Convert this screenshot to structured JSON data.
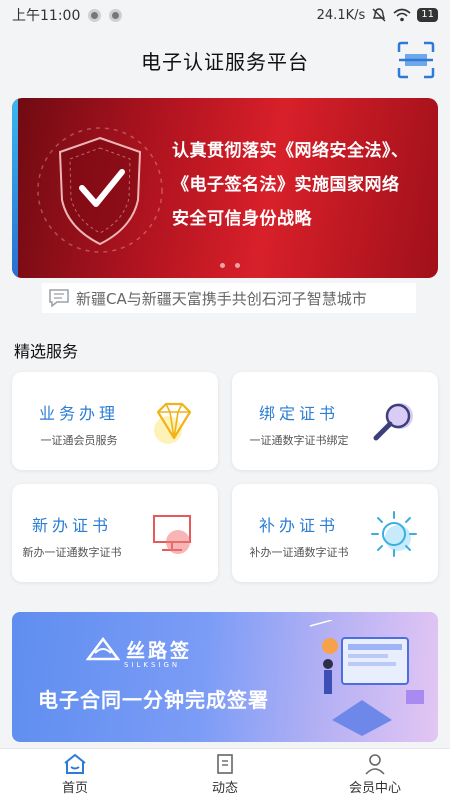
{
  "status_bar": {
    "time": "上午11:00",
    "net_speed": "24.1K/s",
    "battery": "11"
  },
  "header": {
    "title": "电子认证服务平台",
    "scan_icon": "scan-icon"
  },
  "banner": {
    "line1": "认真贯彻落实《网络安全法》、",
    "line2": "《电子签名法》实施国家网络",
    "line3": "安全可信身份战略",
    "accent": "#c8141e"
  },
  "news": {
    "text": "新疆CA与新疆天富携手共创石河子智慧城市"
  },
  "services": {
    "section_title": "精选服务",
    "items": [
      {
        "title": "业务办理",
        "subtitle": "一证通会员服务",
        "icon": "diamond-icon"
      },
      {
        "title": "绑定证书",
        "subtitle": "一证通数字证书绑定",
        "icon": "magnifier-icon"
      },
      {
        "title": "新办证书",
        "subtitle": "新办一证通数字证书",
        "icon": "monitor-icon"
      },
      {
        "title": "补办证书",
        "subtitle": "补办一证通数字证书",
        "icon": "sun-icon"
      }
    ]
  },
  "promo": {
    "brand": "丝路签",
    "brand_sub": "SILKSIGN",
    "slogan": "电子合同一分钟完成签署"
  },
  "tabbar": {
    "items": [
      {
        "label": "首页",
        "icon": "home-icon"
      },
      {
        "label": "动态",
        "icon": "document-icon"
      },
      {
        "label": "会员中心",
        "icon": "user-icon"
      }
    ]
  }
}
